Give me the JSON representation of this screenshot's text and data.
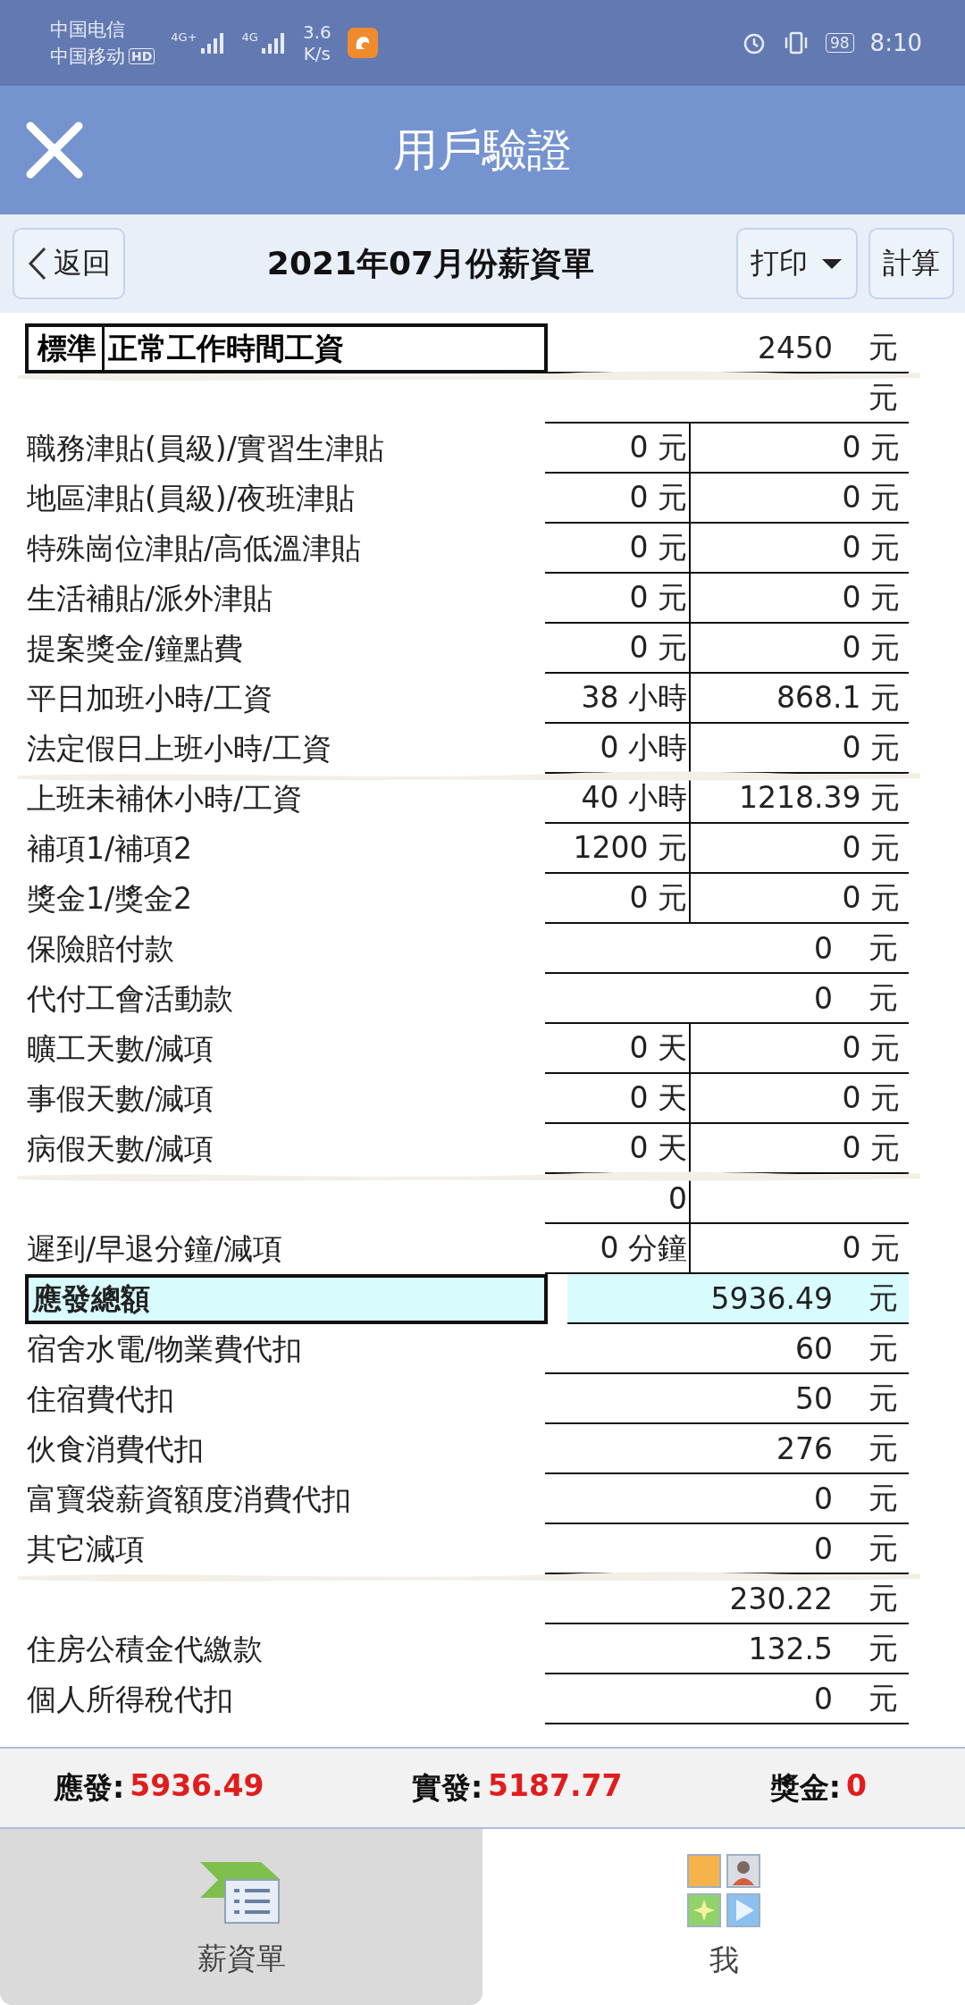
{
  "status_bar": {
    "carriers": [
      "中国电信",
      "中国移动"
    ],
    "hd_badge": "HD",
    "networks": [
      "4G+",
      "4G"
    ],
    "speed": [
      "3.6",
      "K/s"
    ],
    "battery": "98",
    "time": "8:10"
  },
  "header": {
    "title": "用戶驗證"
  },
  "toolbar": {
    "back": "返回",
    "title": "2021年07月份薪資單",
    "print": "打印",
    "calc": "計算"
  },
  "rows": [
    {
      "kind": "boxed",
      "code": "標準",
      "label": "正常工作時間工資",
      "value": "2450",
      "unit": "元"
    },
    {
      "kind": "single",
      "redacted": true,
      "unit": "元"
    },
    {
      "kind": "double",
      "label": "職務津貼(員級)/實習生津貼",
      "a": "0 元",
      "b": "0 元"
    },
    {
      "kind": "double",
      "label": "地區津貼(員級)/夜班津貼",
      "a": "0 元",
      "b": "0 元"
    },
    {
      "kind": "double",
      "label": "特殊崗位津貼/高低溫津貼",
      "a": "0 元",
      "b": "0 元"
    },
    {
      "kind": "double",
      "label": "生活補貼/派外津貼",
      "a": "0 元",
      "b": "0 元"
    },
    {
      "kind": "double",
      "label": "提案獎金/鐘點費",
      "a": "0 元",
      "b": "0 元"
    },
    {
      "kind": "double",
      "label": "平日加班小時/工資",
      "a": "38 小時",
      "b": "868.1 元"
    },
    {
      "kind": "double",
      "label": "法定假日上班小時/工資",
      "a": "0 小時",
      "b": "0 元"
    },
    {
      "kind": "double",
      "redacted": true,
      "label": "上班未補休小時/工資",
      "a": "40 小時",
      "b": "1218.39 元"
    },
    {
      "kind": "double",
      "label": "補項1/補項2",
      "a": "1200 元",
      "b": "0 元"
    },
    {
      "kind": "double",
      "label": "獎金1/獎金2",
      "a": "0 元",
      "b": "0 元"
    },
    {
      "kind": "single",
      "label": "保險賠付款",
      "value": "0",
      "unit": "元"
    },
    {
      "kind": "single",
      "label": "代付工會活動款",
      "value": "0",
      "unit": "元"
    },
    {
      "kind": "double",
      "label": "曠工天數/減項",
      "a": "0 天",
      "b": "0 元"
    },
    {
      "kind": "double",
      "label": "事假天數/減項",
      "a": "0 天",
      "b": "0 元"
    },
    {
      "kind": "double",
      "label": "病假天數/減項",
      "a": "0 天",
      "b": "0 元"
    },
    {
      "kind": "double",
      "redacted": true,
      "a": "0"
    },
    {
      "kind": "double",
      "label": "遲到/早退分鐘/減項",
      "a": "0 分鐘",
      "b": "0 元"
    },
    {
      "kind": "total",
      "label": "應發總額",
      "value": "5936.49",
      "unit": "元"
    },
    {
      "kind": "single",
      "label": "宿舍水電/物業費代扣",
      "value": "60",
      "unit": "元"
    },
    {
      "kind": "single",
      "label": "住宿費代扣",
      "value": "50",
      "unit": "元"
    },
    {
      "kind": "single",
      "label": "伙食消費代扣",
      "value": "276",
      "unit": "元"
    },
    {
      "kind": "single",
      "label": "富寶袋薪資額度消費代扣",
      "value": "0",
      "unit": "元"
    },
    {
      "kind": "single",
      "label": "其它減項",
      "value": "0",
      "unit": "元"
    },
    {
      "kind": "single",
      "redacted": true,
      "value": "230.22",
      "unit": "元"
    },
    {
      "kind": "single",
      "label": "住房公積金代繳款",
      "value": "132.5",
      "unit": "元"
    },
    {
      "kind": "single",
      "label": "個人所得稅代扣",
      "value": "0",
      "unit": "元"
    }
  ],
  "summary": [
    {
      "label": "應發:",
      "value": "5936.49"
    },
    {
      "label": "實發:",
      "value": "5187.77"
    },
    {
      "label": "獎金:",
      "value": "0"
    }
  ],
  "tabs": [
    {
      "label": "薪資單",
      "selected": true
    },
    {
      "label": "我",
      "selected": false
    }
  ]
}
